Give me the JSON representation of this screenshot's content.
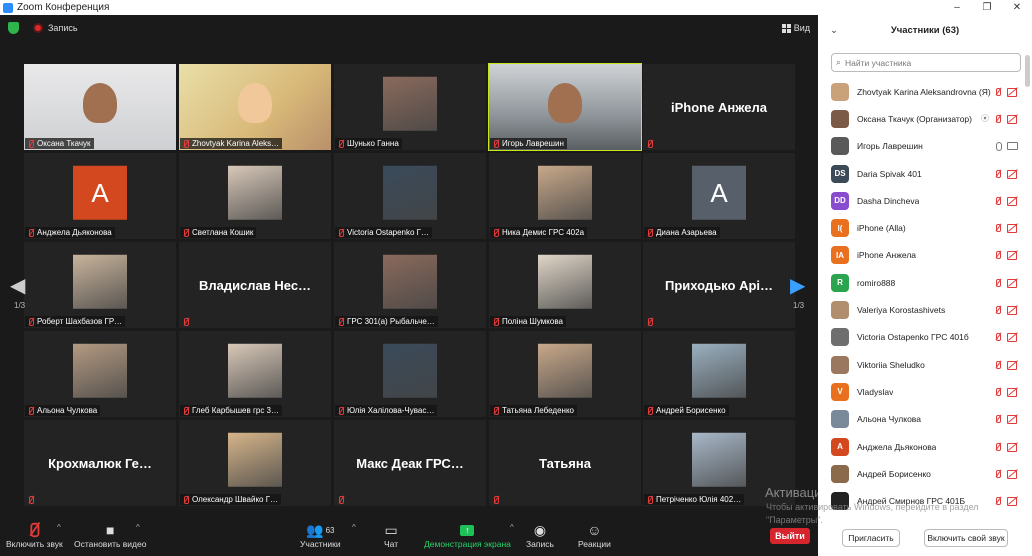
{
  "window": {
    "title": "Zoom Конференция",
    "controls": [
      "–",
      "❐",
      "✕"
    ]
  },
  "topbar": {
    "record_label": "Запись",
    "view_label": "Вид"
  },
  "tiles": [
    {
      "name": "Оксана Ткачук",
      "kind": "video"
    },
    {
      "name": "Zhovtyak Karina Aleks…",
      "kind": "video"
    },
    {
      "name": "Шунько Ганна",
      "kind": "photo"
    },
    {
      "name": "Игорь Лаврешин",
      "kind": "video",
      "active": true
    },
    {
      "name": "",
      "big": "iPhone Анжела",
      "kind": "text"
    },
    {
      "name": "Анджела Дьяконова",
      "kind": "avatar",
      "letter": "A",
      "color": "#d4481f"
    },
    {
      "name": "Светлана Кошик",
      "kind": "photo"
    },
    {
      "name": "Victoria Ostapenko  Г…",
      "kind": "photo"
    },
    {
      "name": "Ника Демис ГРС 402а",
      "kind": "photo"
    },
    {
      "name": "Диана Азарьева",
      "kind": "avatar",
      "letter": "A",
      "color": "#57606a"
    },
    {
      "name": "Роберт Шахбазов ГР…",
      "kind": "photo"
    },
    {
      "name": "",
      "big": "Владислав  Нес…",
      "kind": "text"
    },
    {
      "name": "ГРС 301(а) Рыбальче…",
      "kind": "photo"
    },
    {
      "name": "Поліна Шумкова",
      "kind": "photo"
    },
    {
      "name": "",
      "big": "Приходько Арі…",
      "kind": "text"
    },
    {
      "name": "Альона Чулкова",
      "kind": "photo"
    },
    {
      "name": "Глеб Карбышев грс 3…",
      "kind": "photo"
    },
    {
      "name": "Юлія Халілова-Чувас…",
      "kind": "photo"
    },
    {
      "name": "Татьяна Лебеденко",
      "kind": "photo"
    },
    {
      "name": "Андрей Борисенко",
      "kind": "photo"
    },
    {
      "name": "",
      "big": "Крохмалюк  Ге…",
      "kind": "text"
    },
    {
      "name": "Олександр Швайко Г…",
      "kind": "photo"
    },
    {
      "name": "",
      "big": "Макс Деак ГРС…",
      "kind": "text"
    },
    {
      "name": "",
      "big": "Татьяна",
      "kind": "text"
    },
    {
      "name": "Петріченко Юлія 402…",
      "kind": "photo"
    }
  ],
  "pager": {
    "left": "1/3",
    "right": "1/3"
  },
  "toolbar": {
    "mute": "Включить звук",
    "video": "Остановить видео",
    "participants": "Участники",
    "participants_count": "63",
    "chat": "Чат",
    "share": "Демонстрация экрана",
    "record": "Запись",
    "reactions": "Реакции",
    "leave": "Выйти"
  },
  "panel": {
    "title": "Участники (63)",
    "search_placeholder": "Найти участника",
    "invite": "Пригласить",
    "unmute_me": "Включить свой звук",
    "participants": [
      {
        "name": "Zhovtyak Karina Aleksandrovna (Я)",
        "initials": "",
        "color": "#caa27a",
        "mic": "off",
        "cam": "off"
      },
      {
        "name": "Оксана Ткачук (Организатор)",
        "initials": "",
        "color": "#7b5a48",
        "mic": "off",
        "cam": "off",
        "host": true
      },
      {
        "name": "Игорь Лаврешин",
        "initials": "",
        "color": "#5a5a5a",
        "mic": "on",
        "cam": "on"
      },
      {
        "name": "Daria Spivak 401",
        "initials": "DS",
        "color": "#3c4a57",
        "mic": "off",
        "cam": "off"
      },
      {
        "name": "Dasha Dincheva",
        "initials": "DD",
        "color": "#8a4ccf",
        "mic": "off",
        "cam": "off"
      },
      {
        "name": "iPhone (Alla)",
        "initials": "I(",
        "color": "#e8701e",
        "mic": "off",
        "cam": "off"
      },
      {
        "name": "iPhone Анжела",
        "initials": "IA",
        "color": "#e8701e",
        "mic": "off",
        "cam": "off"
      },
      {
        "name": "romiro888",
        "initials": "R",
        "color": "#2aa44f",
        "mic": "off",
        "cam": "off"
      },
      {
        "name": "Valeriya Korostashivets",
        "initials": "",
        "color": "#b08e6e",
        "mic": "off",
        "cam": "off"
      },
      {
        "name": "Victoria Ostapenko  ГРС 401б",
        "initials": "",
        "color": "#6e6e6e",
        "mic": "off",
        "cam": "off"
      },
      {
        "name": "Viktoriia Sheludko",
        "initials": "",
        "color": "#9a7860",
        "mic": "off",
        "cam": "off"
      },
      {
        "name": "Vladyslav",
        "initials": "V",
        "color": "#e8701e",
        "mic": "off",
        "cam": "off"
      },
      {
        "name": "Альона Чулкова",
        "initials": "",
        "color": "#7a8a9a",
        "mic": "off",
        "cam": "off"
      },
      {
        "name": "Анджела Дьяконова",
        "initials": "A",
        "color": "#d4481f",
        "mic": "off",
        "cam": "off"
      },
      {
        "name": "Андрей Борисенко",
        "initials": "",
        "color": "#8a6a4a",
        "mic": "off",
        "cam": "off"
      },
      {
        "name": "Андрей Смирнов ГРС 401Б",
        "initials": "",
        "color": "#222222",
        "mic": "off",
        "cam": "off"
      }
    ]
  },
  "watermark": {
    "title": "Активация Windows",
    "line1": "Чтобы активировать Windows, перейдите в раздел",
    "line2": "\"Параметры\"."
  }
}
